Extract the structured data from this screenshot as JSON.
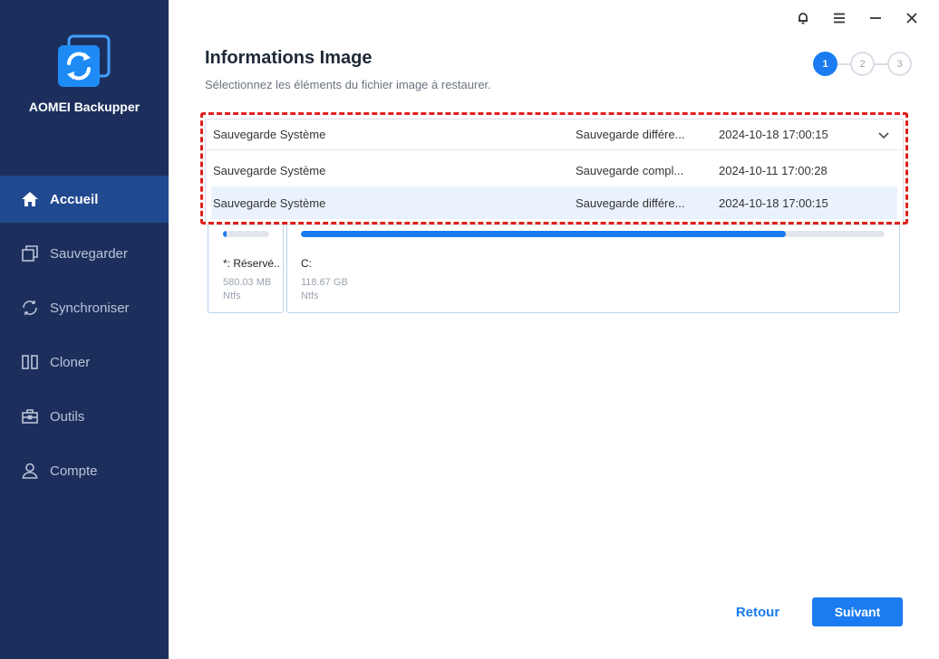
{
  "app": {
    "name": "AOMEI Backupper",
    "logo_icon": "sync-logo-icon",
    "sidebar_color": "#1c2f5c",
    "accent_color": "#1a7cf0"
  },
  "sidebar": {
    "items": [
      {
        "label": "Accueil",
        "icon": "home-icon",
        "active": true
      },
      {
        "label": "Sauvegarder",
        "icon": "backup-icon",
        "active": false
      },
      {
        "label": "Synchroniser",
        "icon": "sync-icon",
        "active": false
      },
      {
        "label": "Cloner",
        "icon": "clone-icon",
        "active": false
      },
      {
        "label": "Outils",
        "icon": "toolbox-icon",
        "active": false
      },
      {
        "label": "Compte",
        "icon": "user-icon",
        "active": false
      }
    ]
  },
  "window_controls": [
    "bell-icon",
    "menu-icon",
    "minimize-icon",
    "close-icon"
  ],
  "header": {
    "title": "Informations Image",
    "subtitle": "Sélectionnez les éléments du fichier image à restaurer."
  },
  "steps": [
    "1",
    "2",
    "3"
  ],
  "current_step": 1,
  "dropdown": {
    "selected": {
      "name": "Sauvegarde Système",
      "type": "Sauvegarde différe...",
      "date": "2024-10-18 17:00:15"
    },
    "options": [
      {
        "name": "Sauvegarde Système",
        "type": "Sauvegarde compl...",
        "date": "2024-10-11 17:00:28",
        "selected": false
      },
      {
        "name": "Sauvegarde Système",
        "type": "Sauvegarde différe...",
        "date": "2024-10-18 17:00:15",
        "selected": true
      }
    ]
  },
  "partitions": [
    {
      "label": "*: Réservé...",
      "size": "580.03 MB",
      "fs": "Ntfs",
      "used_fraction": 0.08
    },
    {
      "label": "C:",
      "size": "118.67 GB",
      "fs": "Ntfs",
      "used_fraction": 0.83
    }
  ],
  "footer": {
    "back_label": "Retour",
    "next_label": "Suivant"
  }
}
